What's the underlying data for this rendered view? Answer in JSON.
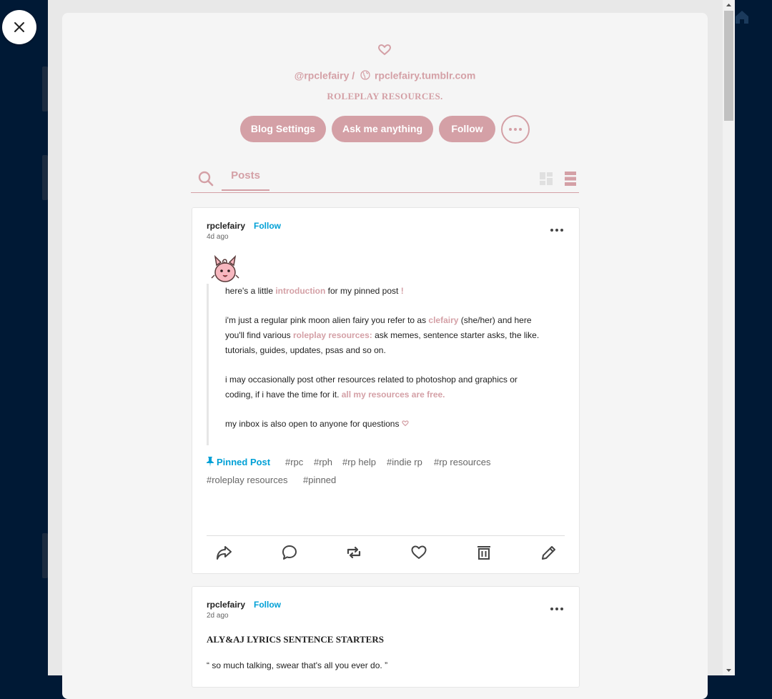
{
  "blog": {
    "handle": "@rpclefairy",
    "separator": "/",
    "url": "rpclefairy.tumblr.com",
    "description": "ROLEPLAY RESOURCES.",
    "accent_color": "#d4a0a6",
    "buttons": {
      "settings": "Blog Settings",
      "ask": "Ask me anything",
      "follow": "Follow"
    }
  },
  "tabs": {
    "posts": "Posts"
  },
  "posts": [
    {
      "author": "rpclefairy",
      "follow": "Follow",
      "time": "4d ago",
      "body": [
        {
          "parts": [
            "here's a little ",
            "introduction",
            " for my pinned post ",
            "!"
          ]
        },
        {
          "parts": [
            "i'm just a regular pink moon alien fairy you refer to as ",
            "clefairy",
            " (she/her) and here"
          ]
        },
        {
          "parts": [
            "you'll find various ",
            "roleplay resources:",
            " ask memes, sentence starter asks, the like."
          ]
        },
        {
          "parts": [
            "tutorials, guides, updates, psas and so on."
          ]
        },
        {
          "parts": [
            "i may occasionally post other resources related to photoshop and graphics or"
          ]
        },
        {
          "parts": [
            "coding, if i have the time for it. ",
            "all my resources are free."
          ]
        },
        {
          "parts": [
            "my inbox is also open to anyone for questions "
          ]
        }
      ],
      "pinned_label": "Pinned Post",
      "tags": [
        "#rpc",
        "#rph",
        "#rp help",
        "#indie rp",
        "#rp resources",
        "#roleplay resources",
        "#pinned"
      ],
      "footer_icons": [
        "share-icon",
        "reply-icon",
        "reblog-icon",
        "like-icon",
        "delete-icon",
        "edit-icon"
      ]
    },
    {
      "author": "rpclefairy",
      "follow": "Follow",
      "time": "2d ago",
      "title": "ALY&AJ LYRICS SENTENCE STARTERS",
      "line": "“ so much talking, swear that's all you ever do. ”"
    }
  ]
}
